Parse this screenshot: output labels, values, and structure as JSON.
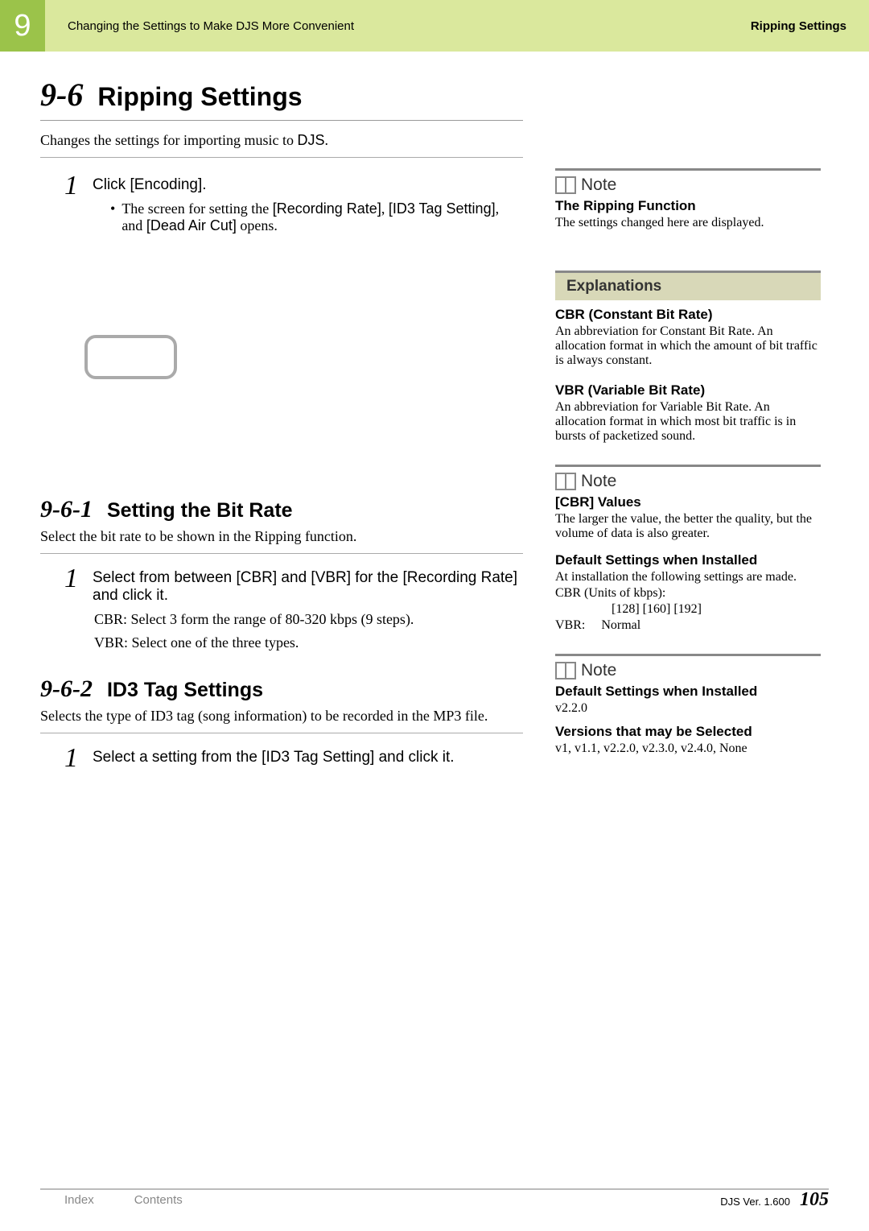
{
  "header": {
    "chapter": "9",
    "left": "Changing the Settings to Make DJS More Convenient",
    "right": "Ripping Settings"
  },
  "section": {
    "num": "9-6",
    "title": "Ripping Settings",
    "desc_a": "Changes the settings for importing music to ",
    "desc_b": "DJS",
    "desc_c": "."
  },
  "step1": {
    "num": "1",
    "main_a": "Click ",
    "main_b": "[Encoding]",
    "main_c": ".",
    "bullet_a": "The screen for setting the ",
    "bullet_b": "[Recording Rate]",
    "bullet_c": ", ",
    "bullet_d": "[ID3 Tag Setting]",
    "bullet_e": ", and ",
    "bullet_f": "[Dead Air Cut]",
    "bullet_g": " opens."
  },
  "subsec1": {
    "num": "9-6-1",
    "title": "Setting the Bit Rate",
    "desc": "Select the bit rate to be shown in the Ripping function.",
    "step_num": "1",
    "step_main": "Select from between [CBR] and [VBR] for the [Recording Rate] and click it.",
    "step_line1": "CBR: Select 3 form the range of 80-320 kbps (9 steps).",
    "step_line2": "VBR: Select one of the three types."
  },
  "subsec2": {
    "num": "9-6-2",
    "title": "ID3 Tag Settings",
    "desc": "Selects the type of ID3 tag (song information) to be recorded in the MP3 file.",
    "step_num": "1",
    "step_main": "Select a setting from the [ID3 Tag Setting] and click it."
  },
  "side": {
    "note_label": "Note",
    "exp_label": "Explanations",
    "note1_title": "The Ripping Function",
    "note1_body": "The settings changed here are displayed.",
    "exp1_title": "CBR (Constant Bit Rate)",
    "exp1_body": "An abbreviation for Constant Bit Rate. An allocation format in which the amount of bit traffic is always constant.",
    "exp2_title": "VBR (Variable Bit Rate)",
    "exp2_body": "An abbreviation for Variable Bit Rate. An allocation format in which most bit traffic is in bursts of packetized sound.",
    "note2_title": "[CBR] Values",
    "note2_body": "The larger the value, the better the quality, but the volume of data is also greater.",
    "note2b_title": "Default Settings when Installed",
    "note2b_l1": "At installation the following settings are made.",
    "note2b_l2": "CBR (Units of kbps):",
    "note2b_l3": "[128] [160] [192]",
    "note2b_l4": "VBR:     Normal",
    "note3_title": "Default Settings when Installed",
    "note3_body": "v2.2.0",
    "note3b_title": "Versions that may be Selected",
    "note3b_body": "v1, v1.1, v2.2.0, v2.3.0, v2.4.0, None"
  },
  "footer": {
    "index": "Index",
    "contents": "Contents",
    "ver": "DJS Ver. 1.600",
    "page": "105"
  }
}
